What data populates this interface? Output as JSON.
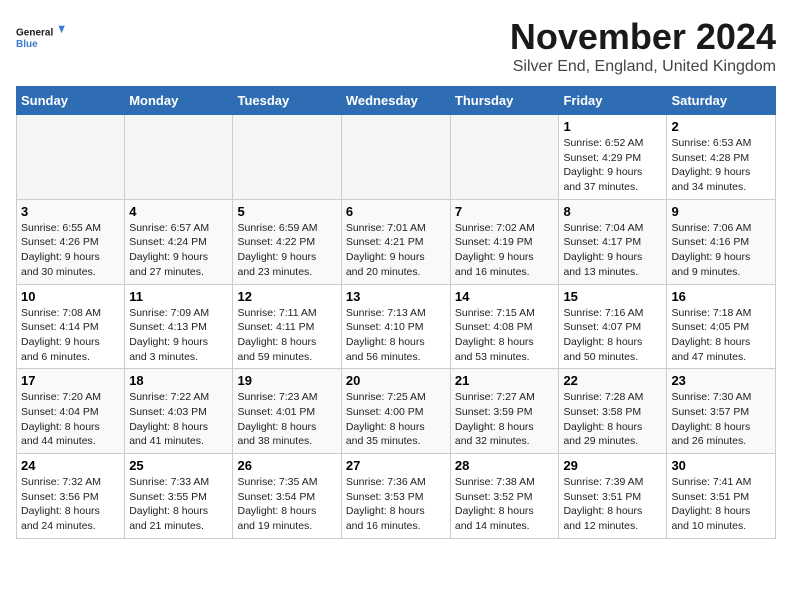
{
  "logo": {
    "line1": "General",
    "line2": "Blue"
  },
  "title": "November 2024",
  "location": "Silver End, England, United Kingdom",
  "weekdays": [
    "Sunday",
    "Monday",
    "Tuesday",
    "Wednesday",
    "Thursday",
    "Friday",
    "Saturday"
  ],
  "weeks": [
    [
      {
        "day": "",
        "info": ""
      },
      {
        "day": "",
        "info": ""
      },
      {
        "day": "",
        "info": ""
      },
      {
        "day": "",
        "info": ""
      },
      {
        "day": "",
        "info": ""
      },
      {
        "day": "1",
        "info": "Sunrise: 6:52 AM\nSunset: 4:29 PM\nDaylight: 9 hours\nand 37 minutes."
      },
      {
        "day": "2",
        "info": "Sunrise: 6:53 AM\nSunset: 4:28 PM\nDaylight: 9 hours\nand 34 minutes."
      }
    ],
    [
      {
        "day": "3",
        "info": "Sunrise: 6:55 AM\nSunset: 4:26 PM\nDaylight: 9 hours\nand 30 minutes."
      },
      {
        "day": "4",
        "info": "Sunrise: 6:57 AM\nSunset: 4:24 PM\nDaylight: 9 hours\nand 27 minutes."
      },
      {
        "day": "5",
        "info": "Sunrise: 6:59 AM\nSunset: 4:22 PM\nDaylight: 9 hours\nand 23 minutes."
      },
      {
        "day": "6",
        "info": "Sunrise: 7:01 AM\nSunset: 4:21 PM\nDaylight: 9 hours\nand 20 minutes."
      },
      {
        "day": "7",
        "info": "Sunrise: 7:02 AM\nSunset: 4:19 PM\nDaylight: 9 hours\nand 16 minutes."
      },
      {
        "day": "8",
        "info": "Sunrise: 7:04 AM\nSunset: 4:17 PM\nDaylight: 9 hours\nand 13 minutes."
      },
      {
        "day": "9",
        "info": "Sunrise: 7:06 AM\nSunset: 4:16 PM\nDaylight: 9 hours\nand 9 minutes."
      }
    ],
    [
      {
        "day": "10",
        "info": "Sunrise: 7:08 AM\nSunset: 4:14 PM\nDaylight: 9 hours\nand 6 minutes."
      },
      {
        "day": "11",
        "info": "Sunrise: 7:09 AM\nSunset: 4:13 PM\nDaylight: 9 hours\nand 3 minutes."
      },
      {
        "day": "12",
        "info": "Sunrise: 7:11 AM\nSunset: 4:11 PM\nDaylight: 8 hours\nand 59 minutes."
      },
      {
        "day": "13",
        "info": "Sunrise: 7:13 AM\nSunset: 4:10 PM\nDaylight: 8 hours\nand 56 minutes."
      },
      {
        "day": "14",
        "info": "Sunrise: 7:15 AM\nSunset: 4:08 PM\nDaylight: 8 hours\nand 53 minutes."
      },
      {
        "day": "15",
        "info": "Sunrise: 7:16 AM\nSunset: 4:07 PM\nDaylight: 8 hours\nand 50 minutes."
      },
      {
        "day": "16",
        "info": "Sunrise: 7:18 AM\nSunset: 4:05 PM\nDaylight: 8 hours\nand 47 minutes."
      }
    ],
    [
      {
        "day": "17",
        "info": "Sunrise: 7:20 AM\nSunset: 4:04 PM\nDaylight: 8 hours\nand 44 minutes."
      },
      {
        "day": "18",
        "info": "Sunrise: 7:22 AM\nSunset: 4:03 PM\nDaylight: 8 hours\nand 41 minutes."
      },
      {
        "day": "19",
        "info": "Sunrise: 7:23 AM\nSunset: 4:01 PM\nDaylight: 8 hours\nand 38 minutes."
      },
      {
        "day": "20",
        "info": "Sunrise: 7:25 AM\nSunset: 4:00 PM\nDaylight: 8 hours\nand 35 minutes."
      },
      {
        "day": "21",
        "info": "Sunrise: 7:27 AM\nSunset: 3:59 PM\nDaylight: 8 hours\nand 32 minutes."
      },
      {
        "day": "22",
        "info": "Sunrise: 7:28 AM\nSunset: 3:58 PM\nDaylight: 8 hours\nand 29 minutes."
      },
      {
        "day": "23",
        "info": "Sunrise: 7:30 AM\nSunset: 3:57 PM\nDaylight: 8 hours\nand 26 minutes."
      }
    ],
    [
      {
        "day": "24",
        "info": "Sunrise: 7:32 AM\nSunset: 3:56 PM\nDaylight: 8 hours\nand 24 minutes."
      },
      {
        "day": "25",
        "info": "Sunrise: 7:33 AM\nSunset: 3:55 PM\nDaylight: 8 hours\nand 21 minutes."
      },
      {
        "day": "26",
        "info": "Sunrise: 7:35 AM\nSunset: 3:54 PM\nDaylight: 8 hours\nand 19 minutes."
      },
      {
        "day": "27",
        "info": "Sunrise: 7:36 AM\nSunset: 3:53 PM\nDaylight: 8 hours\nand 16 minutes."
      },
      {
        "day": "28",
        "info": "Sunrise: 7:38 AM\nSunset: 3:52 PM\nDaylight: 8 hours\nand 14 minutes."
      },
      {
        "day": "29",
        "info": "Sunrise: 7:39 AM\nSunset: 3:51 PM\nDaylight: 8 hours\nand 12 minutes."
      },
      {
        "day": "30",
        "info": "Sunrise: 7:41 AM\nSunset: 3:51 PM\nDaylight: 8 hours\nand 10 minutes."
      }
    ]
  ]
}
